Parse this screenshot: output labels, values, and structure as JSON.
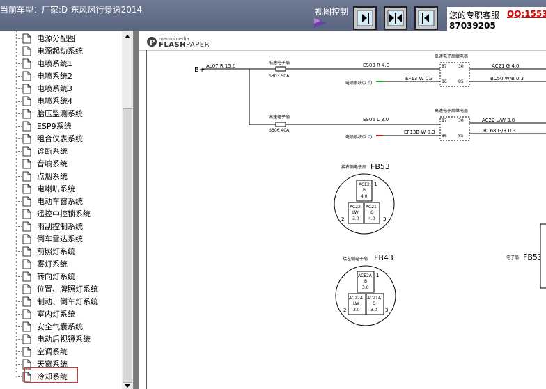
{
  "header": {
    "car_model": "当前车型：厂家:D-东风风行景逸2014",
    "view_control_label": "视图控制",
    "view_buttons": [
      "expand-right",
      "expand-both",
      "collapse-left"
    ]
  },
  "customer_service": {
    "label": "您的专职客服",
    "qq": "QQ:15535",
    "number": "87039205"
  },
  "sidebar": {
    "items": [
      "电源分配图",
      "电源起动系统",
      "电喷系统1",
      "电喷系统2",
      "电喷系统3",
      "电喷系统4",
      "胎压监测系统",
      "ESP9系统",
      "组合仪表系统",
      "诊断系统",
      "音响系统",
      "点烟系统",
      "电喇叭系统",
      "电动车窗系统",
      "遥控中控锁系统",
      "雨刮控制系统",
      "倒车雷达系统",
      "前照灯系统",
      "雾灯系统",
      "转向灯系统",
      "位置、牌照灯系统",
      "制动、倒车灯系统",
      "室内灯系统",
      "安全气囊系统",
      "电动后视镜系统",
      "空调系统",
      "天窗系统",
      "冷却系统"
    ],
    "selected": "冷却系统"
  },
  "viewer": {
    "logo_small": "macromedia",
    "logo_flash": "FLASH",
    "logo_paper": "PAPER"
  },
  "diagram": {
    "b_plus": "B+",
    "main_wire": "AL07 R 15.0",
    "fuse1_label": "低速电子扇",
    "fuse1_id": "SB03 50A",
    "wire_es03": "ES03 R 4.0",
    "relay1_title": "低速电子扇继电器",
    "relay1_pins": [
      "87",
      "30",
      "86",
      "85"
    ],
    "wire_ac21": "AC21 G 4.0",
    "ecu1": "电喷系统(2.0)",
    "wire_ef13": "EF13 W 0.3",
    "wire_bc50": "BC50 W/B 0.3",
    "fuse2_label": "高速电子扇",
    "fuse2_id": "SB06 40A",
    "wire_es06": "ES06 L 3.0",
    "relay2_title": "高速电子扇继电器",
    "relay2_pins": [
      "87",
      "30",
      "86",
      "85"
    ],
    "wire_ac22": "AC22 L/W 3.0",
    "ecu2": "电喷系统(2.0)",
    "wire_ef13b": "EF13B W 0.3",
    "wire_bc68": "BC68 G/R 0.3",
    "conn1_title": "接右侧电子扇",
    "conn1_id": "FB53",
    "conn1_top": [
      "ACE2",
      "B",
      "4.0"
    ],
    "conn1_left": [
      "AC22",
      "LW",
      "3.0"
    ],
    "conn1_right": [
      "AC21",
      "G",
      "4.0"
    ],
    "conn1_pins": [
      "1",
      "2",
      "3"
    ],
    "conn2_title": "接左侧电子扇",
    "conn2_id": "FB43",
    "conn2_top": [
      "ACE2A",
      "B",
      "3.0"
    ],
    "conn2_left": [
      "AC22A",
      "LW",
      "3.0"
    ],
    "conn2_right": [
      "AC21A",
      "G",
      "3.0"
    ],
    "conn2_pins": [
      "1",
      "2",
      "3"
    ],
    "conn3_title": "电子扇",
    "conn3_id": "FB53"
  }
}
